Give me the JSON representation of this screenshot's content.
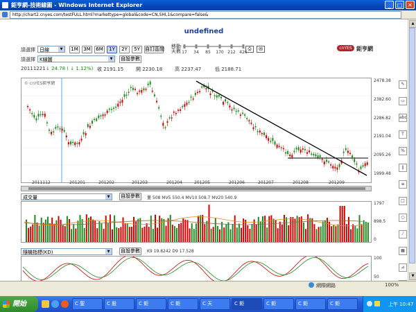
{
  "window": {
    "title": "鉅亨網-技術線圖 - Windows Internet Explorer"
  },
  "address": {
    "url": "http://chart2.cnyes.com/testFULL.html?markettype=global&code=CN,SHI,1&compare=false&"
  },
  "page": {
    "title": "undefined"
  },
  "controls": {
    "select_label": "請選擇",
    "period_select": "日線",
    "chart_select": "K線圖",
    "range_buttons": [
      "1M",
      "3M",
      "6M",
      "1Y",
      "2Y",
      "5Y",
      "自訂區間"
    ],
    "active_range": "1Y",
    "ma_label_top": "移動",
    "ma_label_bottom": "天數",
    "ma_values": [
      "17",
      "34",
      "85",
      "170",
      "212",
      "426"
    ],
    "custom_params": "自設參數",
    "logo_tag": "cnYES",
    "logo_text": "鉅亨網"
  },
  "quote": {
    "date": "20111221",
    "change": "↓ 24.78 ( ↓ 1.12%)",
    "close": "收 2191.15",
    "open": "開 2230.18",
    "high": "高 2237.47",
    "low": "低 2188.71"
  },
  "main_chart": {
    "watermark": "© cnYES鉅亨網",
    "y_ticks": [
      "2478.38",
      "2382.60",
      "2286.82",
      "2191.04",
      "2095.26",
      "1999.48"
    ],
    "x_ticks": [
      "2011112",
      "201201",
      "201202",
      "201203",
      "201204",
      "201205",
      "201206",
      "201207",
      "201208",
      "201209"
    ]
  },
  "volume_panel": {
    "select": "成交量",
    "params": "自設參數",
    "stats": "量 508  MV5 550.4  MV10 508.7  MV20 540.9",
    "y_ticks": [
      "1797",
      "898.5",
      "0"
    ]
  },
  "kd_panel": {
    "select": "隨機指標(KD)",
    "params": "自設參數",
    "stats": "K9 19.8242    D9 17.528",
    "y_ticks": [
      "100",
      "50"
    ]
  },
  "toolbar_icons": [
    "pencil-icon",
    "ruler-icon",
    "abc-icon",
    "text-icon",
    "percent-icon",
    "parallel-icon",
    "fibo-icon",
    "rectangle-icon",
    "ellipse-icon",
    "gann-icon",
    "grid-icon",
    "fan-icon",
    "delete-icon"
  ],
  "status": {
    "zone": "網際網路",
    "zoom": "100%"
  },
  "taskbar": {
    "start": "開始",
    "tasks": [
      "C 聖",
      "C 股",
      "C 鉅",
      "C 鉅",
      "C 天",
      "C 鉅",
      "C 鉅",
      "C 鉅",
      "C 鉅"
    ],
    "clock": "上午 10:47"
  },
  "colors": {
    "up": "#d40000",
    "down": "#1e8a1e",
    "accent": "#1a3da6"
  }
}
